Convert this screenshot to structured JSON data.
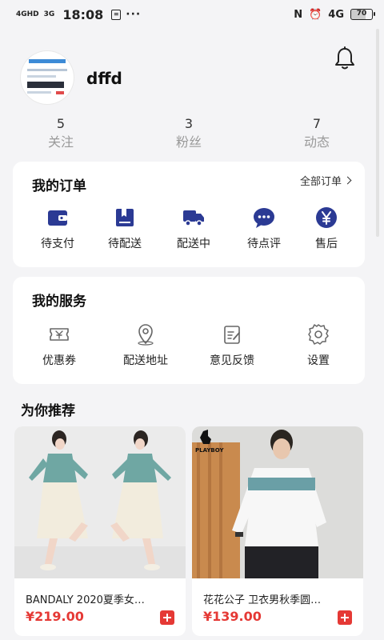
{
  "status_bar": {
    "signal1": "4GHD",
    "signal2": "3G",
    "time": "18:08",
    "more": "···",
    "network": "4G",
    "battery": "70"
  },
  "profile": {
    "username": "dffd",
    "stats": [
      {
        "value": "5",
        "label": "关注"
      },
      {
        "value": "3",
        "label": "粉丝"
      },
      {
        "value": "7",
        "label": "动态"
      }
    ]
  },
  "orders": {
    "title": "我的订单",
    "all_label": "全部订单",
    "items": [
      {
        "label": "待支付",
        "icon": "wallet-icon"
      },
      {
        "label": "待配送",
        "icon": "package-icon"
      },
      {
        "label": "配送中",
        "icon": "truck-icon"
      },
      {
        "label": "待点评",
        "icon": "comment-icon"
      },
      {
        "label": "售后",
        "icon": "yen-icon"
      }
    ]
  },
  "services": {
    "title": "我的服务",
    "items": [
      {
        "label": "优惠券",
        "icon": "coupon-icon"
      },
      {
        "label": "配送地址",
        "icon": "location-icon"
      },
      {
        "label": "意见反馈",
        "icon": "feedback-icon"
      },
      {
        "label": "设置",
        "icon": "gear-icon"
      }
    ]
  },
  "recommend": {
    "title": "为你推荐",
    "products": [
      {
        "name": "BANDALY 2020夏季女…",
        "price": "¥219.00"
      },
      {
        "name": "花花公子 卫衣男秋季圆…",
        "price": "¥139.00"
      }
    ],
    "brand_logo": "PLAYBOY"
  },
  "colors": {
    "accent": "#2b3a94",
    "price": "#e53935",
    "background": "#f4f4f6"
  }
}
